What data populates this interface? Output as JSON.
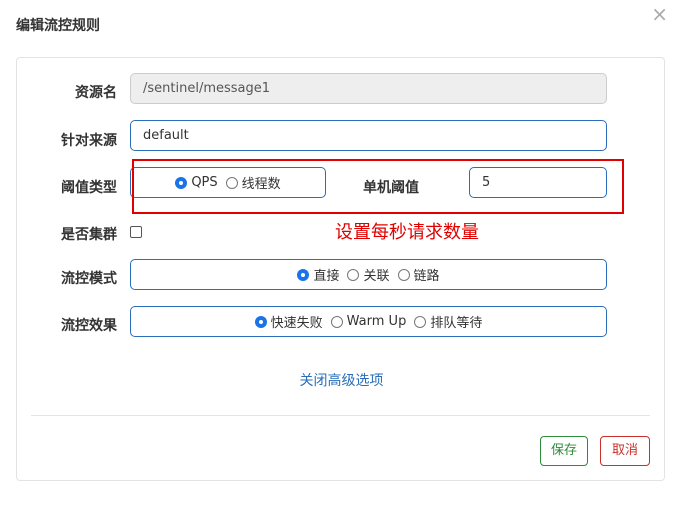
{
  "dialog": {
    "title": "编辑流控规则",
    "close_icon": "close-icon",
    "close_glyph": "×"
  },
  "form": {
    "resource": {
      "label": "资源名",
      "value": "/sentinel/message1"
    },
    "limit_app": {
      "label": "针对来源",
      "value": "default"
    },
    "grade": {
      "label": "阈值类型",
      "options": [
        "QPS",
        "线程数"
      ],
      "selected": "QPS"
    },
    "threshold": {
      "label": "单机阈值",
      "value": "5"
    },
    "cluster": {
      "label": "是否集群",
      "checked": false
    },
    "strategy": {
      "label": "流控模式",
      "options": [
        "直接",
        "关联",
        "链路"
      ],
      "selected": "直接"
    },
    "control_behavior": {
      "label": "流控效果",
      "options": [
        "快速失败",
        "Warm Up",
        "排队等待"
      ],
      "selected": "快速失败"
    },
    "advanced_link": "关闭高级选项"
  },
  "annotation": {
    "text": "设置每秒请求数量",
    "color": "#e00000"
  },
  "footer": {
    "save_label": "保存",
    "cancel_label": "取消"
  },
  "colors": {
    "accent": "#2a6ebb",
    "save": "#2e8b3a",
    "cancel": "#c9302c"
  }
}
